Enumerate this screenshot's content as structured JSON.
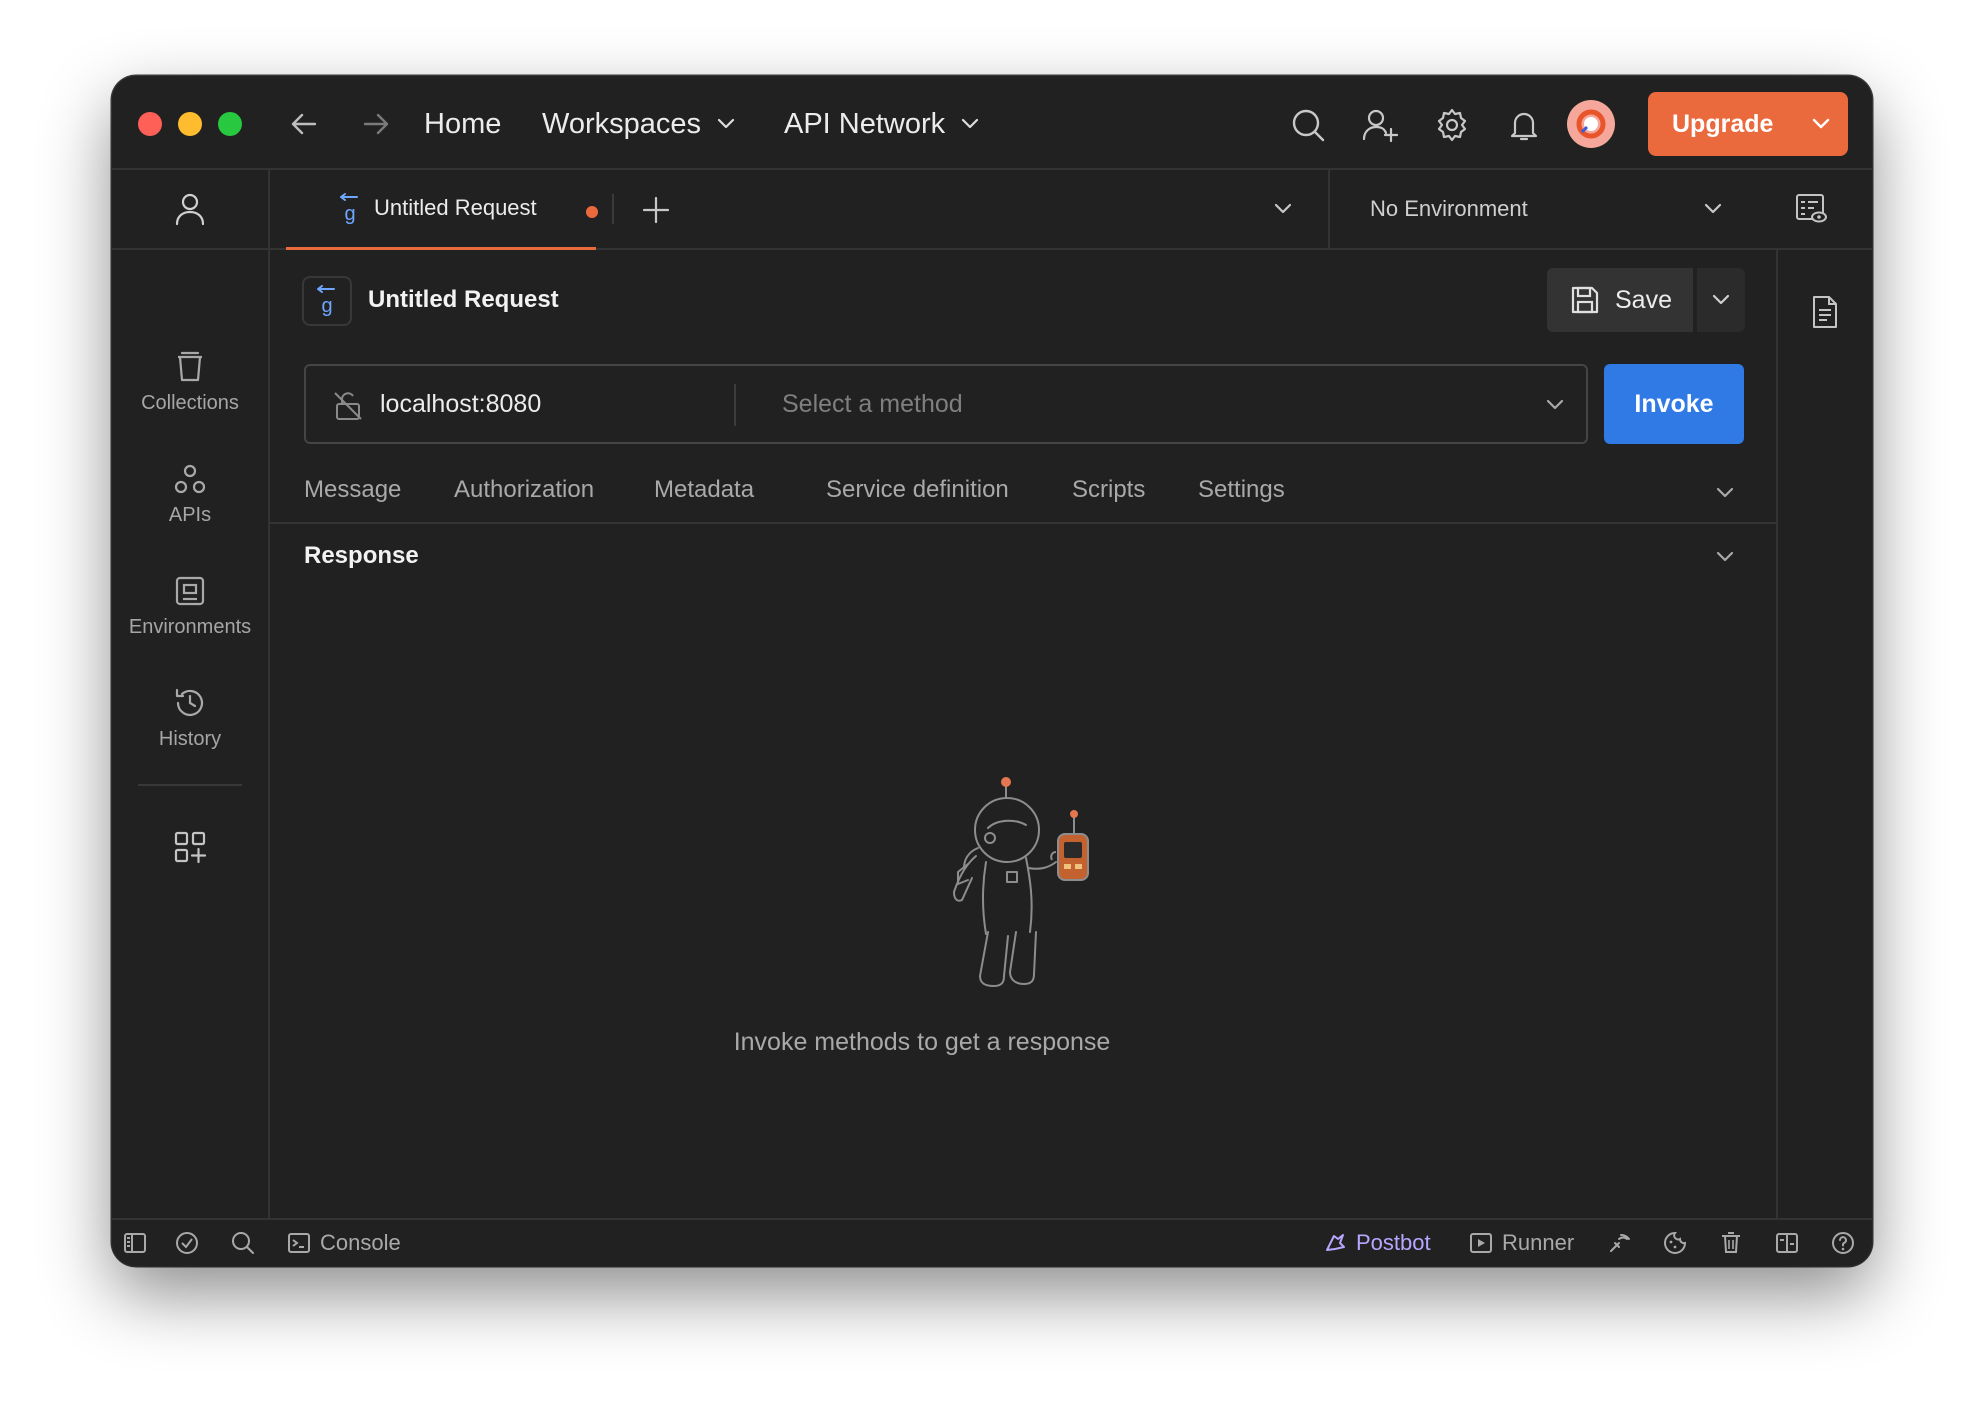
{
  "titlebar": {
    "home": "Home",
    "workspaces": "Workspaces",
    "api_network": "API Network",
    "upgrade": "Upgrade"
  },
  "sidebar": {
    "items": [
      {
        "label": "Collections",
        "icon": "trash-can-icon"
      },
      {
        "label": "APIs",
        "icon": "apis-icon"
      },
      {
        "label": "Environments",
        "icon": "environments-icon"
      },
      {
        "label": "History",
        "icon": "history-icon"
      }
    ]
  },
  "tabs": {
    "active_label": "Untitled Request",
    "environment": "No Environment"
  },
  "request": {
    "title": "Untitled Request",
    "save_label": "Save",
    "url": "localhost:8080",
    "method_placeholder": "Select a method",
    "invoke_label": "Invoke",
    "subtabs": [
      "Message",
      "Authorization",
      "Metadata",
      "Service definition",
      "Scripts",
      "Settings"
    ]
  },
  "response": {
    "title": "Response",
    "empty_message": "Invoke methods to get a response"
  },
  "statusbar": {
    "console": "Console",
    "postbot": "Postbot",
    "runner": "Runner"
  },
  "colors": {
    "accent": "#ea6a3e",
    "invoke": "#2f7ae5",
    "background": "#212121",
    "postbot": "#b8a6ff"
  }
}
